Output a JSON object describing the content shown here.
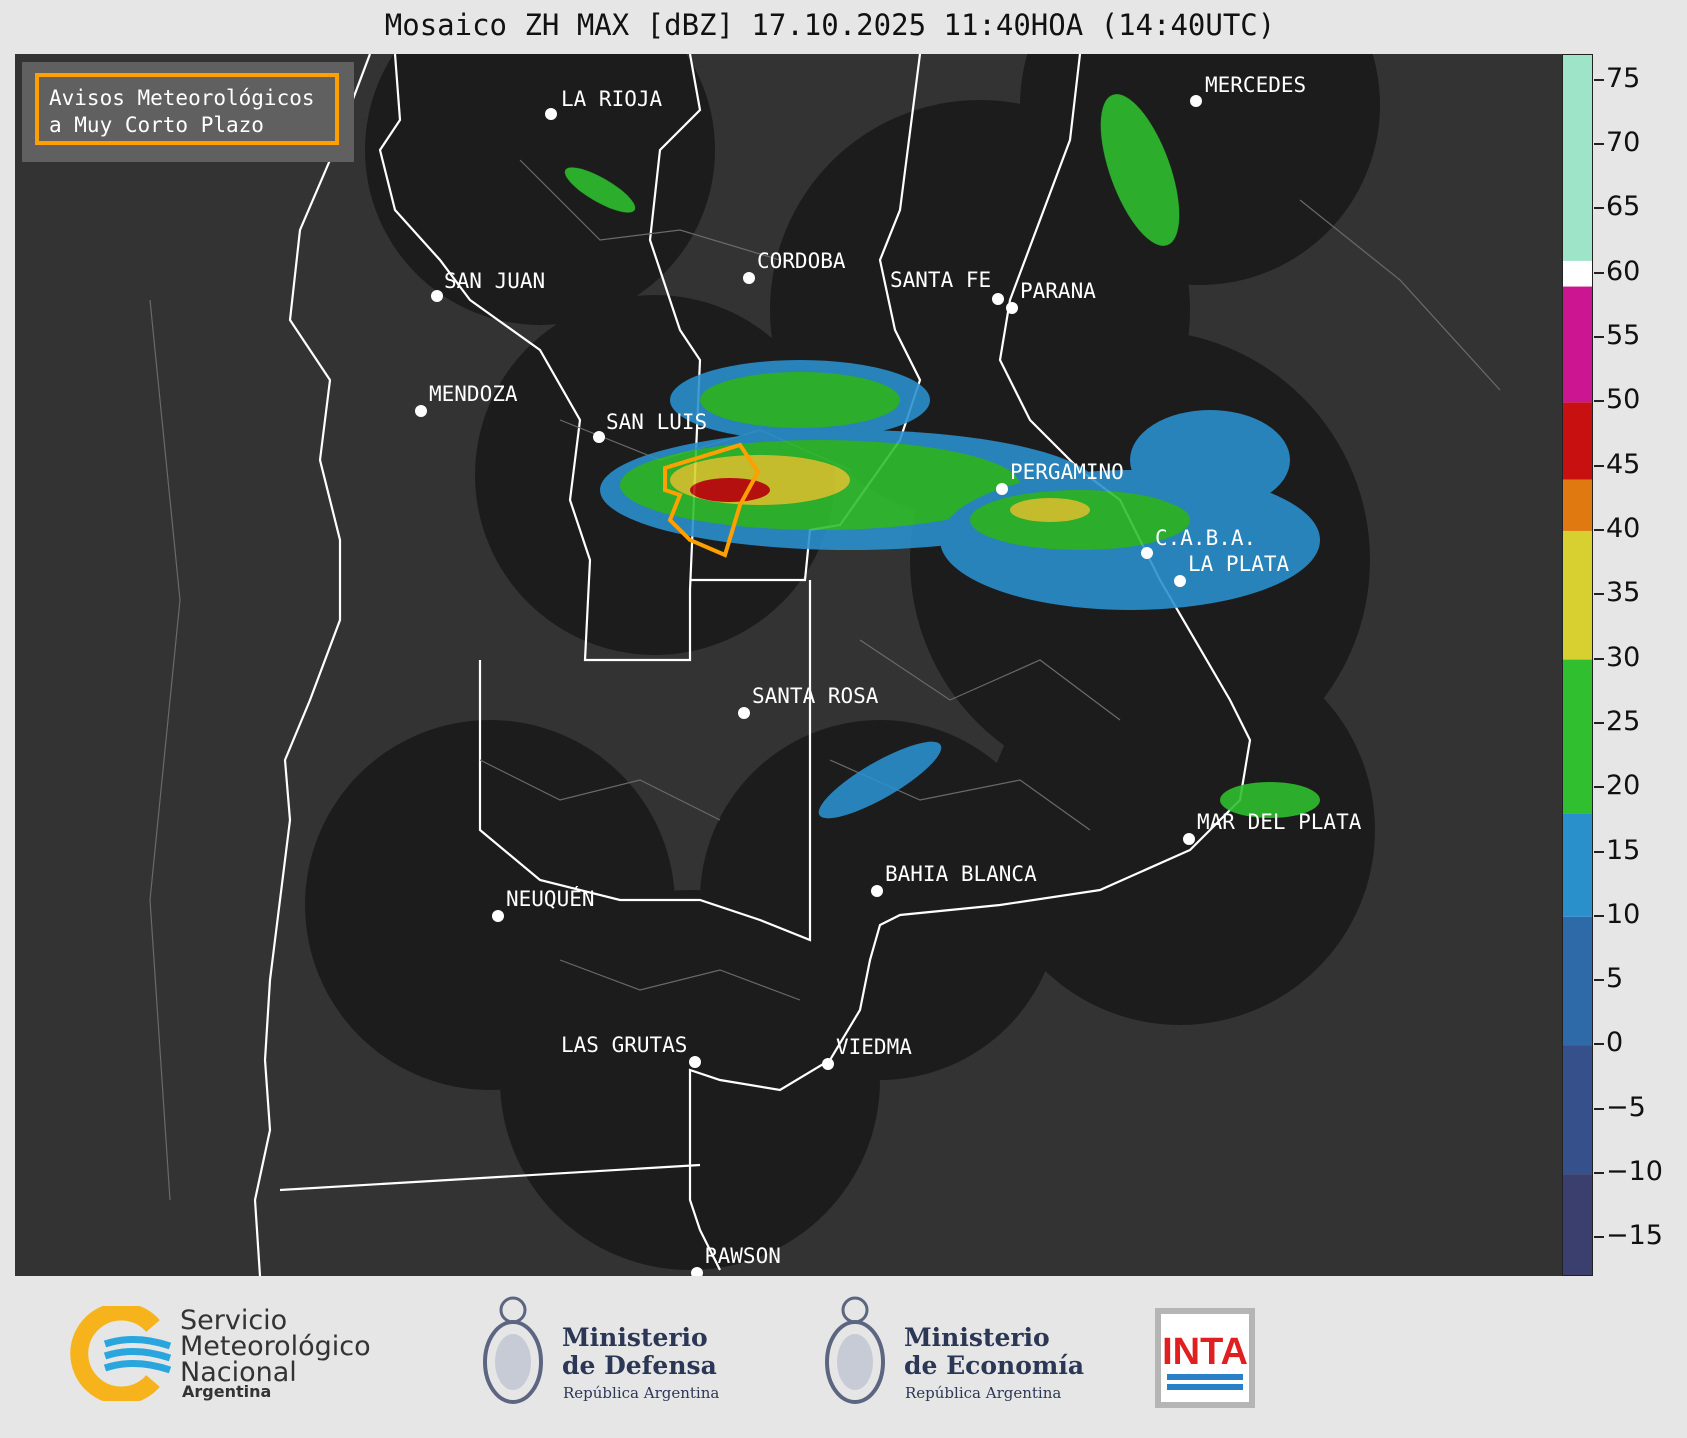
{
  "title": "Mosaico ZH MAX [dBZ] 17.10.2025 11:40HOA (14:40UTC)",
  "warning_box": {
    "line1": "Avisos Meteorológicos",
    "line2": "a Muy Corto Plazo"
  },
  "cities": [
    {
      "name": "LA RIOJA"
    },
    {
      "name": "SAN JUAN"
    },
    {
      "name": "CORDOBA"
    },
    {
      "name": "SANTA FE"
    },
    {
      "name": "PARANA"
    },
    {
      "name": "MERCEDES"
    },
    {
      "name": "MENDOZA"
    },
    {
      "name": "SAN LUIS"
    },
    {
      "name": "PERGAMINO"
    },
    {
      "name": "C.A.B.A."
    },
    {
      "name": "LA PLATA"
    },
    {
      "name": "SANTA ROSA"
    },
    {
      "name": "MAR DEL PLATA"
    },
    {
      "name": "BAHIA BLANCA"
    },
    {
      "name": "NEUQUÉN"
    },
    {
      "name": "LAS GRUTAS"
    },
    {
      "name": "VIEDMA"
    },
    {
      "name": "RAWSON"
    }
  ],
  "colorbar": {
    "min": -18,
    "max": 77,
    "ticks": [
      "75",
      "70",
      "65",
      "60",
      "55",
      "50",
      "45",
      "40",
      "35",
      "30",
      "25",
      "20",
      "15",
      "10",
      "5",
      "0",
      "−5",
      "−10",
      "−15"
    ],
    "tick_values": [
      75,
      70,
      65,
      60,
      55,
      50,
      45,
      40,
      35,
      30,
      25,
      20,
      15,
      10,
      5,
      0,
      -5,
      -10,
      -15
    ],
    "segments": [
      {
        "from": -18,
        "to": -10,
        "color": "#3a3f6e"
      },
      {
        "from": -10,
        "to": 0,
        "color": "#35508a"
      },
      {
        "from": 0,
        "to": 10,
        "color": "#2e6aa8"
      },
      {
        "from": 10,
        "to": 18,
        "color": "#2a90cc"
      },
      {
        "from": 18,
        "to": 30,
        "color": "#2fbf2f"
      },
      {
        "from": 30,
        "to": 40,
        "color": "#d8d030"
      },
      {
        "from": 40,
        "to": 44,
        "color": "#e07a10"
      },
      {
        "from": 44,
        "to": 50,
        "color": "#c81010"
      },
      {
        "from": 50,
        "to": 59,
        "color": "#cc1590"
      },
      {
        "from": 59,
        "to": 61,
        "color": "#ffffff"
      },
      {
        "from": 61,
        "to": 77,
        "color": "#9ee4c8"
      }
    ]
  },
  "logos": {
    "smn": {
      "line1": "Servicio",
      "line2": "Meteorológico",
      "line3": "Nacional",
      "line4": "Argentina"
    },
    "defensa": {
      "line1": "Ministerio",
      "line2": "de Defensa",
      "sub": "República Argentina"
    },
    "economia": {
      "line1": "Ministerio",
      "line2": "de Economía",
      "sub": "República Argentina"
    },
    "inta": {
      "text": "INTA"
    }
  }
}
